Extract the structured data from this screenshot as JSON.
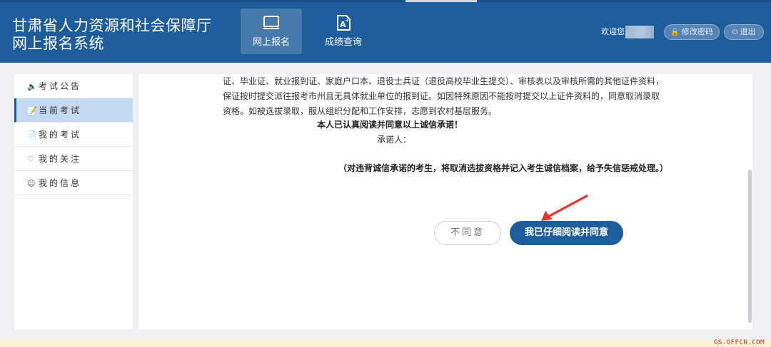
{
  "header": {
    "title": "甘肃省人力资源和社会保障厅网上报名系统",
    "tabs": [
      {
        "label": "网上报名",
        "icon": "monitor-icon",
        "active": true
      },
      {
        "label": "成绩查询",
        "icon": "document-star-icon",
        "active": false
      }
    ],
    "welcome": "欢迎您，",
    "change_password": "修改密码",
    "logout": "退出"
  },
  "sidebar": {
    "items": [
      {
        "label": "考试公告",
        "icon": "speaker-icon",
        "active": false
      },
      {
        "label": "当前考试",
        "icon": "exam-paper-icon",
        "active": true
      },
      {
        "label": "我的考试",
        "icon": "id-card-icon",
        "active": false
      },
      {
        "label": "我的关注",
        "icon": "heart-icon",
        "active": false
      },
      {
        "label": "我的信息",
        "icon": "user-icon",
        "active": false
      }
    ]
  },
  "main": {
    "paragraph": "证、毕业证、就业报到证、家庭户口本、退役士兵证（退役高校毕业生提交）、审核表以及审核所需的其他证件资料，保证按时提交派往报考市州且无具体就业单位的报到证。如因特殊原因不能按时提交以上证件资料的，同意取消录取资格。如被选拔录取，服从组织分配和工作安排，志愿到农村基层服务。",
    "commitment": "本人已认真阅读并同意以上诚信承诺！",
    "signer": "承诺人：",
    "warning": "（对违背诚信承诺的考生，将取消选拔资格并记入考生诚信档案，给予失信惩戒处理。）",
    "disagree_button": "不同意",
    "agree_button": "我已仔细阅读并同意"
  },
  "watermark": "GS.OFFCN.COM",
  "colors": {
    "header_bg": "#1e5d9c",
    "accent": "#1e5d9c",
    "sidebar_active": "#c3d9f0",
    "arrow": "#e8332a"
  }
}
